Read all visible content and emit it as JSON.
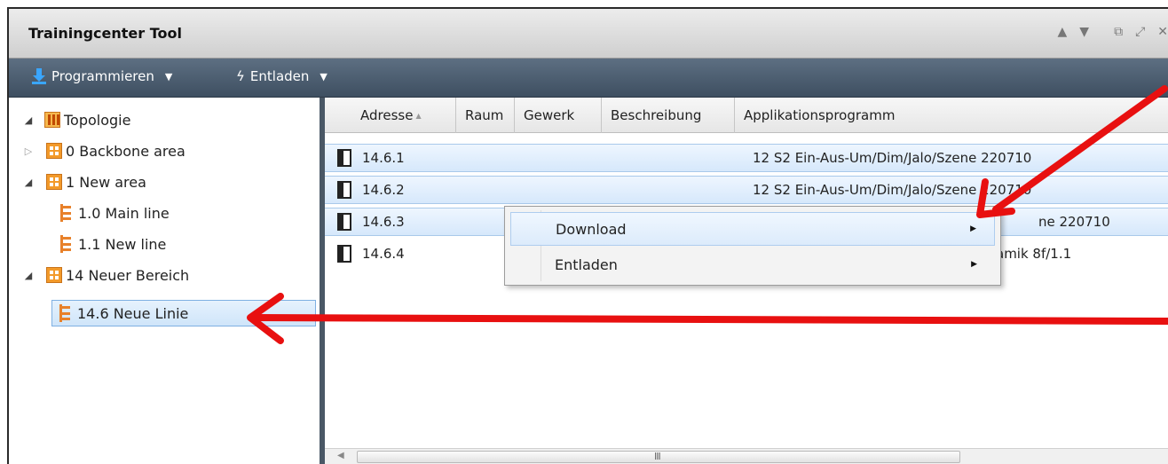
{
  "window": {
    "title": "Trainingcenter Tool"
  },
  "toolbar": {
    "program_label": "Programmieren",
    "unload_label": "Entladen"
  },
  "tree": {
    "root": "Topologie",
    "items": [
      {
        "label": "0 Backbone area"
      },
      {
        "label": "1 New area"
      },
      {
        "label": "1.0 Main line"
      },
      {
        "label": "1.1 New line"
      },
      {
        "label": "14 Neuer Bereich"
      },
      {
        "label": "14.6 Neue Linie"
      }
    ]
  },
  "grid": {
    "columns": [
      "Adresse",
      "Raum",
      "Gewerk",
      "Beschreibung",
      "Applikationsprogramm"
    ],
    "rows": [
      {
        "address": "14.6.1",
        "app": "12 S2 Ein-Aus-Um/Dim/Jalo/Szene 220710"
      },
      {
        "address": "14.6.2",
        "app": "12 S2 Ein-Aus-Um/Dim/Jalo/Szene 220710"
      },
      {
        "address": "14.6.3",
        "app": "ne 220710"
      },
      {
        "address": "14.6.4",
        "app": "amik 8f/1.1"
      }
    ],
    "scroll_grip": "III"
  },
  "context_menu": {
    "items": [
      {
        "label": "Download"
      },
      {
        "label": "Entladen"
      }
    ]
  },
  "annotations": {
    "arrow_color": "#e81010"
  }
}
